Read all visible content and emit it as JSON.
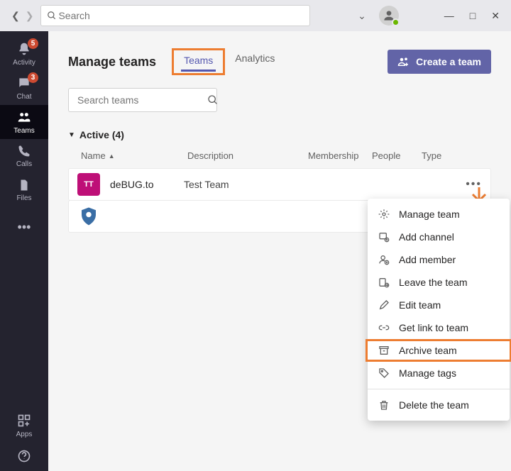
{
  "titlebar": {
    "search_placeholder": "Search"
  },
  "rail": {
    "items": [
      {
        "key": "activity",
        "label": "Activity",
        "badge": "5"
      },
      {
        "key": "chat",
        "label": "Chat",
        "badge": "3"
      },
      {
        "key": "teams",
        "label": "Teams",
        "selected": true
      },
      {
        "key": "calls",
        "label": "Calls"
      },
      {
        "key": "files",
        "label": "Files"
      }
    ],
    "apps_label": "Apps"
  },
  "page": {
    "title": "Manage teams",
    "tabs": [
      {
        "label": "Teams",
        "active": true
      },
      {
        "label": "Analytics"
      }
    ],
    "create_label": "Create a team",
    "search_placeholder": "Search teams"
  },
  "section": {
    "title": "Active (4)"
  },
  "columns": {
    "name": "Name",
    "description": "Description",
    "membership": "Membership",
    "people": "People",
    "type": "Type"
  },
  "rows": [
    {
      "icon_text": "TT",
      "icon_class": "ti-purple",
      "name": "deBUG.to",
      "description": "Test Team"
    },
    {
      "icon_text": "",
      "icon_class": "ti-badgeimg",
      "name": "",
      "description": ""
    }
  ],
  "ctx": {
    "items": [
      {
        "key": "manage",
        "label": "Manage team",
        "icon": "gear"
      },
      {
        "key": "addchannel",
        "label": "Add channel",
        "icon": "channel"
      },
      {
        "key": "addmember",
        "label": "Add member",
        "icon": "member"
      },
      {
        "key": "leave",
        "label": "Leave the team",
        "icon": "leave"
      },
      {
        "key": "edit",
        "label": "Edit team",
        "icon": "pencil"
      },
      {
        "key": "link",
        "label": "Get link to team",
        "icon": "link"
      },
      {
        "key": "archive",
        "label": "Archive team",
        "icon": "archive",
        "highlight": true
      },
      {
        "key": "tags",
        "label": "Manage tags",
        "icon": "tag"
      }
    ],
    "delete_label": "Delete the team"
  }
}
